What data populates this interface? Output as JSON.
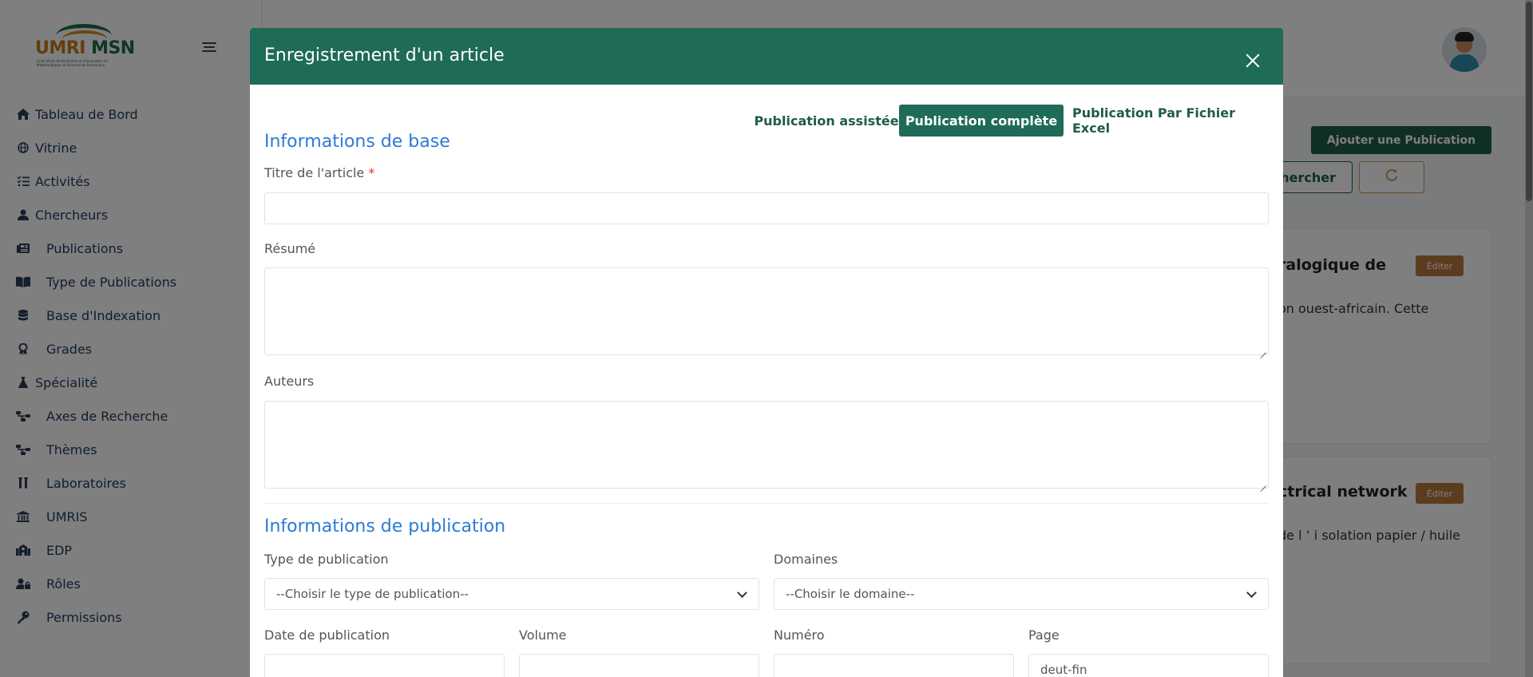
{
  "app": {
    "logo_text_a": "UMRI",
    "logo_text_b": "MSN",
    "logo_sub": "Unité Mixte de Recherche et d'Innovation en Mathématiques et Sciences du Numérique"
  },
  "sidebar": {
    "items": [
      {
        "label": "Tableau de Bord",
        "icon": "home-icon"
      },
      {
        "label": "Vitrine",
        "icon": "globe-icon"
      },
      {
        "label": "Activités",
        "icon": "list-check-icon"
      },
      {
        "label": "Chercheurs",
        "icon": "user-icon"
      },
      {
        "label": "Publications",
        "icon": "newspaper-icon"
      },
      {
        "label": "Type de Publications",
        "icon": "book-open-icon"
      },
      {
        "label": "Base d'Indexation",
        "icon": "database-icon"
      },
      {
        "label": "Grades",
        "icon": "award-icon"
      },
      {
        "label": "Spécialité",
        "icon": "flask-icon"
      },
      {
        "label": "Axes de Recherche",
        "icon": "sitemap-icon"
      },
      {
        "label": "Thèmes",
        "icon": "sitemap-icon"
      },
      {
        "label": "Laboratoires",
        "icon": "test-tubes-icon"
      },
      {
        "label": "UMRIS",
        "icon": "bank-icon"
      },
      {
        "label": "EDP",
        "icon": "school-icon"
      },
      {
        "label": "Rôles",
        "icon": "user-lock-icon"
      },
      {
        "label": "Permissions",
        "icon": "key-icon"
      }
    ]
  },
  "background": {
    "add_publication": "Ajouter une Publication",
    "search_label": "hercher",
    "refresh_icon": "refresh-icon",
    "cards": [
      {
        "title": "ralogique de",
        "text": "on ouest-africain. Cette",
        "badge": "Éditer"
      },
      {
        "title": "ctrical network",
        "text": "de l ’ i solation papier / huile",
        "badge": "Éditer"
      }
    ]
  },
  "modal": {
    "title": "Enregistrement d'un article",
    "tabs": [
      {
        "label": "Publication assistée",
        "active": false
      },
      {
        "label": "Publication complète",
        "active": true
      },
      {
        "label": "Publication Par Fichier Excel",
        "active": false
      }
    ],
    "section_base": "Informations de base",
    "title_label": "Titre de l'article",
    "title_required": "*",
    "title_value": "",
    "resume_label": "Résumé",
    "resume_value": "",
    "authors_label": "Auteurs",
    "authors_value": "",
    "section_publication": "Informations de publication",
    "type_label": "Type de publication",
    "type_selected": "--Choisir le type de publication--",
    "domains_label": "Domaines",
    "domains_selected": "--Choisir le domaine--",
    "date_label": "Date de publication",
    "date_value": "",
    "volume_label": "Volume",
    "volume_value": "",
    "number_label": "Numéro",
    "number_value": "",
    "page_label": "Page",
    "page_placeholder": "deut-fin"
  },
  "colors": {
    "primary": "#1e6b58",
    "section_title": "#2b7bd6",
    "badge": "#b9793d"
  }
}
